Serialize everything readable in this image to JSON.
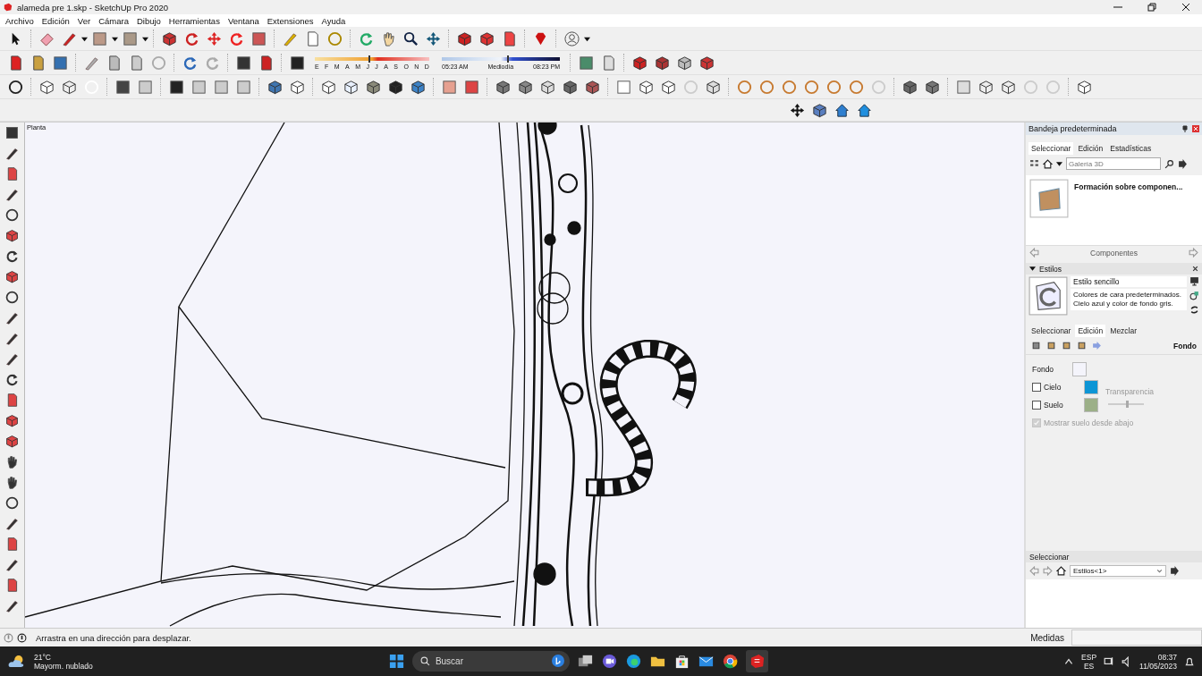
{
  "window": {
    "title": "alameda pre 1.skp - SketchUp Pro 2020"
  },
  "menu": [
    "Archivo",
    "Edición",
    "Ver",
    "Cámara",
    "Dibujo",
    "Herramientas",
    "Ventana",
    "Extensiones",
    "Ayuda"
  ],
  "month_slider": {
    "labels": [
      "E",
      "F",
      "M",
      "A",
      "M",
      "J",
      "J",
      "A",
      "S",
      "O",
      "N",
      "D"
    ],
    "level": 0.47
  },
  "time_slider": {
    "start": "05:23 AM",
    "middle": "Mediodía",
    "end": "08:23 PM",
    "level": 0.55
  },
  "canvas": {
    "view_label": "Planta"
  },
  "tray": {
    "title": "Bandeja predeterminada",
    "components": {
      "tabs": [
        {
          "label": "Seleccionar",
          "selected": true
        },
        {
          "label": "Edición",
          "selected": false
        },
        {
          "label": "Estadísticas",
          "selected": false
        }
      ],
      "search": {
        "placeholder": "Galería 3D"
      },
      "item_title": "Formación sobre componen...",
      "footer": "Componentes"
    },
    "styles": {
      "header": "Estilos",
      "expanded": true,
      "name": "Estilo sencillo",
      "description": "Colores de cara predeterminados. Cielo azul y color de fondo gris.",
      "tabs": [
        {
          "label": "Seleccionar",
          "selected": false
        },
        {
          "label": "Edición",
          "selected": true
        },
        {
          "label": "Mezclar",
          "selected": false
        }
      ],
      "section": "Fondo",
      "settings": [
        {
          "kind": "color",
          "label": "Fondo",
          "color": "#f4f4fb"
        },
        {
          "kind": "check_color",
          "label": "Cielo",
          "checked": false,
          "color": "#0d95d5"
        },
        {
          "kind": "check_color",
          "label": "Suelo",
          "checked": false,
          "color": "#9cb088"
        }
      ],
      "transparency": {
        "label": "Transparencia",
        "disabled": true,
        "level": 0.5
      },
      "show_ground": {
        "label": "Mostrar suelo desde abajo",
        "checked": true,
        "disabled": true
      }
    },
    "select_panel": {
      "header": "Seleccionar",
      "dropdown": "Estilos<1>"
    }
  },
  "status_bar": {
    "message": "Arrastra en una dirección para desplazar.",
    "measurements_label": "Medidas"
  },
  "taskbar": {
    "weather_temp": "21°C",
    "weather_text": "Mayorm. nublado",
    "search": {
      "placeholder": "Buscar"
    },
    "language": "ESP",
    "layout": "ES",
    "time": "08:37",
    "date": "11/05/2023"
  }
}
